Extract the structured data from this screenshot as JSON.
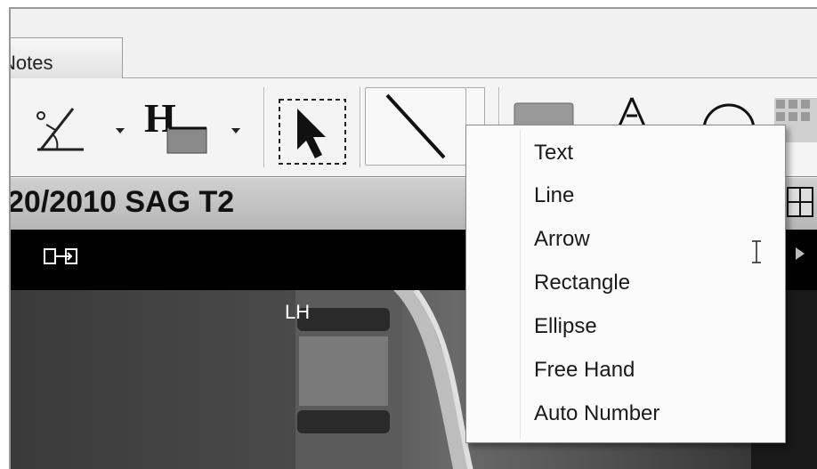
{
  "tabs": {
    "notes_label": "Notes"
  },
  "toolbar": {
    "tools": [
      "angle-tool",
      "hounsfield-tool",
      "select-tool",
      "line-tool",
      "roi-tool",
      "cobb-tool",
      "ellipse-tool",
      "grid-tool"
    ]
  },
  "series": {
    "title": "20/2010 SAG T2"
  },
  "viewer": {
    "orientation_label": "LH"
  },
  "annotation_menu": {
    "items": [
      "Text",
      "Line",
      "Arrow",
      "Rectangle",
      "Ellipse",
      "Free Hand",
      "Auto Number"
    ]
  }
}
